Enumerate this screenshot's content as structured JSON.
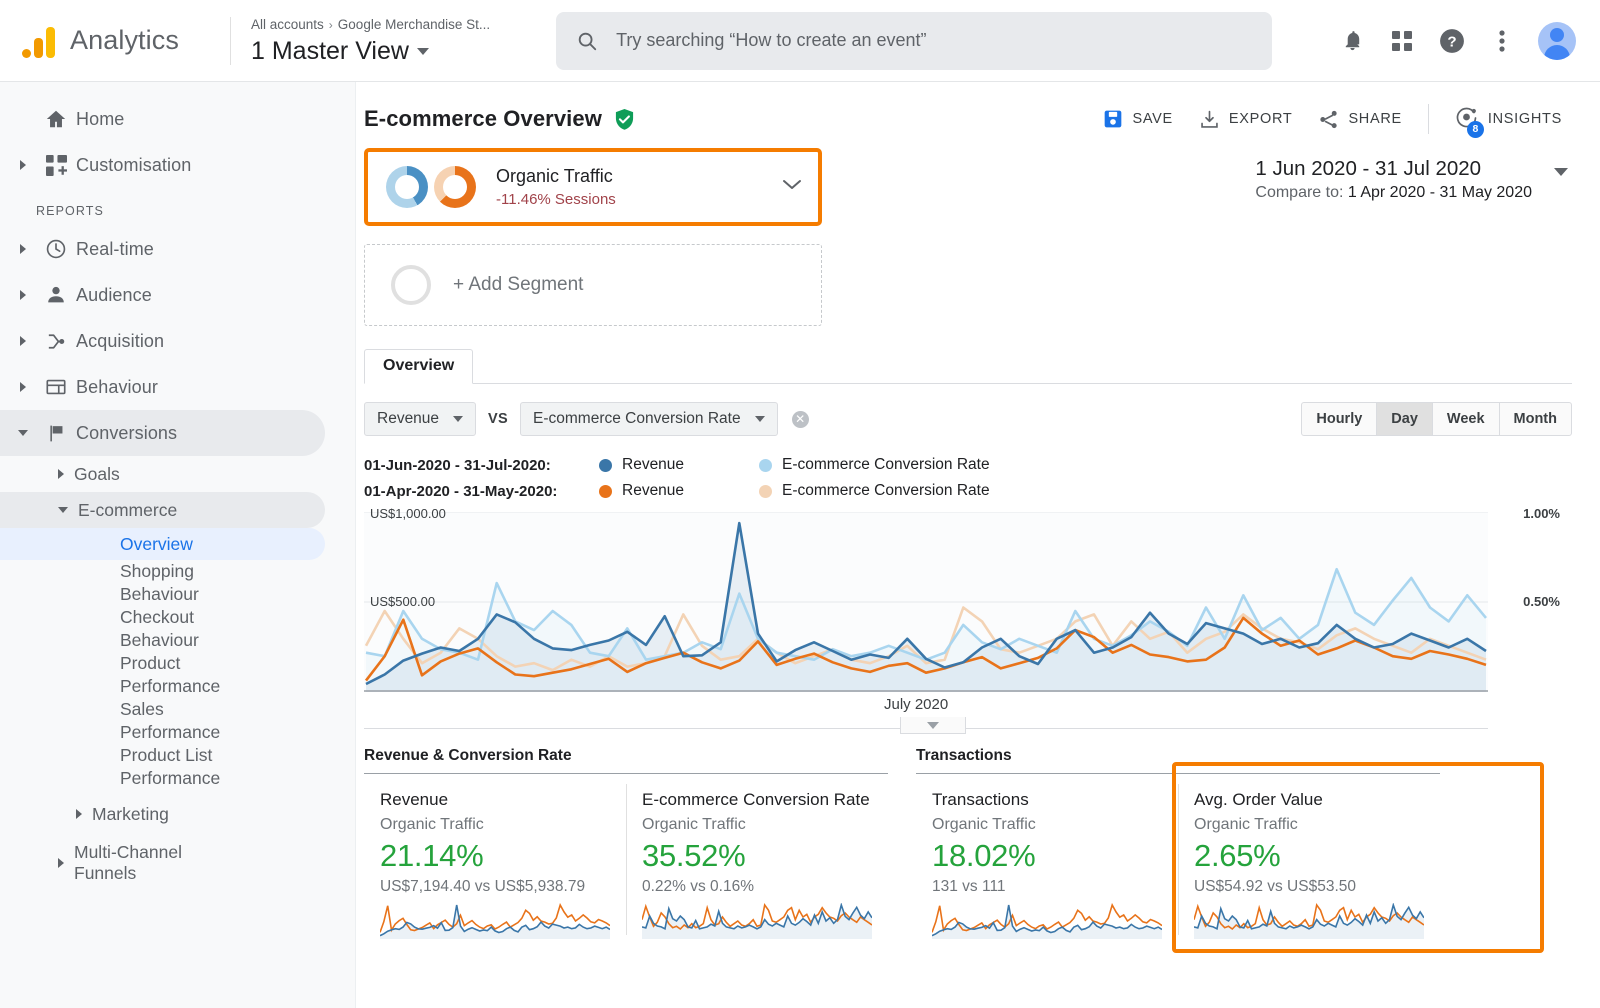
{
  "header": {
    "brand": "Analytics",
    "breadcrumb_all": "All accounts",
    "breadcrumb_sep": "›",
    "breadcrumb_account": "Google Merchandise St...",
    "view_name": "1 Master View",
    "search_placeholder": "Try searching “How to create an event”",
    "icons": [
      "notifications-bell-icon",
      "apps-grid-icon",
      "help-circle-icon",
      "more-vert-icon",
      "avatar"
    ]
  },
  "sidebar": {
    "items": [
      {
        "label": "Home",
        "icon": "home-icon",
        "expandable": false
      },
      {
        "label": "Customisation",
        "icon": "customisation-icon",
        "expandable": true
      }
    ],
    "section_label": "REPORTS",
    "reports": [
      {
        "label": "Real-time",
        "icon": "clock-icon",
        "expandable": true,
        "selected": false
      },
      {
        "label": "Audience",
        "icon": "person-icon",
        "expandable": true,
        "selected": false
      },
      {
        "label": "Acquisition",
        "icon": "acquisition-icon",
        "expandable": true,
        "selected": false
      },
      {
        "label": "Behaviour",
        "icon": "behaviour-icon",
        "expandable": true,
        "selected": false
      },
      {
        "label": "Conversions",
        "icon": "flag-icon",
        "expandable": true,
        "selected": true,
        "expanded": true
      }
    ],
    "conversions_children": [
      {
        "label": "Goals",
        "expanded": false
      },
      {
        "label": "E-commerce",
        "expanded": true
      }
    ],
    "ecommerce_children": [
      {
        "label": "Overview",
        "active": true
      },
      {
        "label": "Shopping Behaviour",
        "active": false
      },
      {
        "label": "Checkout Behaviour",
        "active": false
      },
      {
        "label": "Product Performance",
        "active": false
      },
      {
        "label": "Sales Performance",
        "active": false
      },
      {
        "label": "Product List Performance",
        "active": false
      }
    ],
    "marketing": "Marketing",
    "multi_channel": "Multi-Channel Funnels"
  },
  "page": {
    "title": "E-commerce Overview",
    "verified_icon": "verified-shield-icon",
    "actions": [
      {
        "label": "SAVE",
        "icon": "save-icon"
      },
      {
        "label": "EXPORT",
        "icon": "export-download-icon"
      },
      {
        "label": "SHARE",
        "icon": "share-icon"
      },
      {
        "label": "INSIGHTS",
        "icon": "insights-icon",
        "badge": "8"
      }
    ]
  },
  "segment": {
    "name": "Organic Traffic",
    "delta": "-11.46% Sessions",
    "chevron_icon": "chevron-down-icon",
    "highlight_color": "#f57c00",
    "add_segment_label": "+ Add Segment"
  },
  "date_range": {
    "primary": "1 Jun 2020 - 31 Jul 2020",
    "compare_prefix": "Compare to: ",
    "compare": "1 Apr 2020 - 31 May 2020"
  },
  "tabs": [
    {
      "label": "Overview",
      "active": true
    }
  ],
  "metric_controls": {
    "metric_a": "Revenue",
    "vs": "VS",
    "metric_b": "E-commerce Conversion Rate",
    "clear_icon": "clear-circle-icon",
    "granularity": [
      {
        "label": "Hourly",
        "active": false
      },
      {
        "label": "Day",
        "active": true
      },
      {
        "label": "Week",
        "active": false
      },
      {
        "label": "Month",
        "active": false
      }
    ]
  },
  "chart_data": {
    "type": "line",
    "title": "",
    "xlabel": "July 2020",
    "ylabel": "Revenue",
    "y2label": "E-commerce Conversion Rate",
    "y_ticks_left": [
      "US$500.00",
      "US$1,000.00"
    ],
    "y_ticks_right": [
      "0.50%",
      "1.00%"
    ],
    "ylim": [
      0,
      1000
    ],
    "y2lim": [
      0,
      1.0
    ],
    "grid": true,
    "legend_position": "top",
    "legend_rows": [
      {
        "dates": "01-Jun-2020 - 31-Jul-2020:",
        "entries": [
          {
            "name": "Revenue",
            "color": "#3a76a8"
          },
          {
            "name": "E-commerce Conversion Rate",
            "color": "#a9d5ef"
          }
        ]
      },
      {
        "dates": "01-Apr-2020 - 31-May-2020:",
        "entries": [
          {
            "name": "Revenue",
            "color": "#e8731a"
          },
          {
            "name": "E-commerce Conversion Rate",
            "color": "#f3d3b5"
          }
        ]
      }
    ],
    "series": [
      {
        "name": "Revenue (01-Jun-2020 - 31-Jul-2020)",
        "color": "#3a76a8",
        "values": [
          40,
          95,
          175,
          215,
          250,
          230,
          300,
          440,
          395,
          300,
          245,
          235,
          265,
          290,
          340,
          265,
          430,
          200,
          205,
          280,
          965,
          330,
          170,
          235,
          280,
          230,
          180,
          210,
          190,
          300,
          185,
          135,
          165,
          250,
          300,
          200,
          155,
          300,
          350,
          220,
          250,
          310,
          450,
          330,
          270,
          390,
          360,
          330,
          270,
          300,
          250,
          275,
          380,
          300,
          250,
          270,
          330,
          290,
          250,
          300,
          230
        ]
      },
      {
        "name": "E-commerce Conversion Rate (01-Jun-2020 - 31-Jul-2020)",
        "color": "#a9d5ef",
        "values": [
          0.22,
          0.2,
          0.46,
          0.3,
          0.24,
          0.22,
          0.18,
          0.62,
          0.4,
          0.35,
          0.46,
          0.38,
          0.22,
          0.2,
          0.36,
          0.18,
          0.2,
          0.22,
          0.28,
          0.24,
          0.56,
          0.3,
          0.22,
          0.2,
          0.18,
          0.24,
          0.2,
          0.22,
          0.26,
          0.22,
          0.18,
          0.22,
          0.38,
          0.28,
          0.24,
          0.3,
          0.26,
          0.22,
          0.46,
          0.3,
          0.26,
          0.32,
          0.4,
          0.34,
          0.26,
          0.48,
          0.3,
          0.55,
          0.35,
          0.42,
          0.3,
          0.38,
          0.7,
          0.45,
          0.38,
          0.52,
          0.65,
          0.48,
          0.4,
          0.55,
          0.42
        ]
      },
      {
        "name": "Revenue (01-Apr-2020 - 31-May-2020)",
        "color": "#e8731a",
        "values": [
          60,
          200,
          410,
          90,
          170,
          215,
          245,
          165,
          95,
          85,
          105,
          125,
          155,
          185,
          110,
          160,
          190,
          220,
          165,
          130,
          175,
          285,
          150,
          185,
          215,
          165,
          130,
          110,
          145,
          160,
          105,
          130,
          165,
          195,
          130,
          160,
          190,
          245,
          350,
          310,
          220,
          265,
          210,
          195,
          170,
          180,
          250,
          420,
          330,
          260,
          290,
          210,
          245,
          290,
          250,
          200,
          185,
          230,
          210,
          185,
          150
        ]
      },
      {
        "name": "E-commerce Conversion Rate (01-Apr-2020 - 31-May-2020)",
        "color": "#f3d3b5",
        "values": [
          0.26,
          0.46,
          0.3,
          0.16,
          0.22,
          0.36,
          0.3,
          0.2,
          0.14,
          0.16,
          0.12,
          0.18,
          0.14,
          0.2,
          0.14,
          0.16,
          0.2,
          0.44,
          0.26,
          0.18,
          0.2,
          0.3,
          0.22,
          0.16,
          0.2,
          0.24,
          0.18,
          0.16,
          0.2,
          0.26,
          0.16,
          0.18,
          0.48,
          0.4,
          0.24,
          0.22,
          0.26,
          0.3,
          0.4,
          0.44,
          0.26,
          0.4,
          0.3,
          0.34,
          0.22,
          0.3,
          0.34,
          0.44,
          0.36,
          0.3,
          0.28,
          0.24,
          0.32,
          0.36,
          0.3,
          0.26,
          0.22,
          0.3,
          0.26,
          0.22,
          0.18
        ]
      }
    ]
  },
  "panels": [
    {
      "title": "Revenue & Conversion Rate",
      "cards": [
        {
          "name": "Revenue",
          "segment": "Organic Traffic",
          "value": "21.14%",
          "compare": "US$7,194.40 vs US$5,938.79",
          "highlight": false
        },
        {
          "name": "E-commerce Conversion Rate",
          "segment": "Organic Traffic",
          "value": "35.52%",
          "compare": "0.22% vs 0.16%",
          "highlight": false
        }
      ]
    },
    {
      "title": "Transactions",
      "cards": [
        {
          "name": "Transactions",
          "segment": "Organic Traffic",
          "value": "18.02%",
          "compare": "131 vs 111",
          "highlight": false
        },
        {
          "name": "Avg. Order Value",
          "segment": "Organic Traffic",
          "value": "2.65%",
          "compare": "US$54.92 vs US$53.50",
          "highlight": true
        }
      ]
    }
  ],
  "colors": {
    "highlight": "#f57c00",
    "positive": "#25a33c",
    "link": "#1a73e8",
    "series_blue": "#3a76a8",
    "series_lightblue": "#a9d5ef",
    "series_orange": "#e8731a",
    "series_peach": "#f3d3b5"
  }
}
